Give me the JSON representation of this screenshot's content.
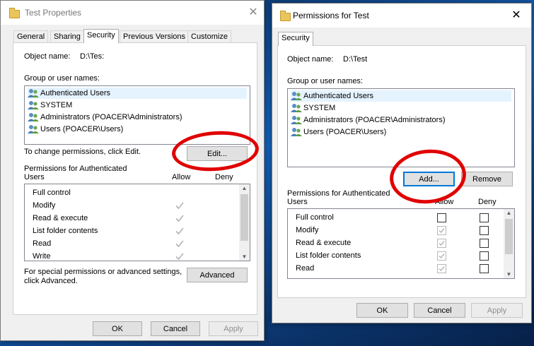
{
  "properties_window": {
    "title": "Test Properties",
    "close_glyph": "✕",
    "tabs": [
      "General",
      "Sharing",
      "Security",
      "Previous Versions",
      "Customize"
    ],
    "active_tab": "Security",
    "object_name_label": "Object name:",
    "object_name_value": "D:\\Tes:",
    "group_label": "Group or user names:",
    "users": [
      "Authenticated Users",
      "SYSTEM",
      "Administrators (POACER\\Administrators)",
      "Users (POACER\\Users)"
    ],
    "change_text": "To change permissions, click Edit.",
    "edit_label": "Edit...",
    "perms_label_line1": "Permissions for Authenticated",
    "perms_label_line2": "Users",
    "allow_label": "Allow",
    "deny_label": "Deny",
    "permissions": [
      "Full control",
      "Modify",
      "Read & execute",
      "List folder contents",
      "Read",
      "Write"
    ],
    "allow_checked": [
      false,
      true,
      true,
      true,
      true,
      true
    ],
    "special_line1": "For special permissions or advanced settings,",
    "special_line2": "click Advanced.",
    "advanced_label": "Advanced",
    "ok_label": "OK",
    "cancel_label": "Cancel",
    "apply_label": "Apply"
  },
  "permissions_window": {
    "title": "Permissions for Test",
    "close_glyph": "✕",
    "tab": "Security",
    "object_name_label": "Object name:",
    "object_name_value": "D:\\Test",
    "group_label": "Group or user names:",
    "users": [
      "Authenticated Users",
      "SYSTEM",
      "Administrators (POACER\\Administrators)",
      "Users (POACER\\Users)"
    ],
    "add_label": "Add...",
    "remove_label": "Remove",
    "perms_label_line1": "Permissions for Authenticated",
    "perms_label_line2": "Users",
    "allow_label": "Allow",
    "deny_label": "Deny",
    "permissions": [
      "Full control",
      "Modify",
      "Read & execute",
      "List folder contents",
      "Read"
    ],
    "allow_checked": [
      false,
      true,
      true,
      true,
      true
    ],
    "allow_disabled": [
      false,
      true,
      true,
      true,
      true
    ],
    "deny_checked": [
      false,
      false,
      false,
      false,
      false
    ],
    "ok_label": "OK",
    "cancel_label": "Cancel",
    "apply_label": "Apply"
  },
  "colors": {
    "annotation_red": "#e00000",
    "focus_blue": "#0078d7",
    "selection": "#e5f3ff"
  }
}
